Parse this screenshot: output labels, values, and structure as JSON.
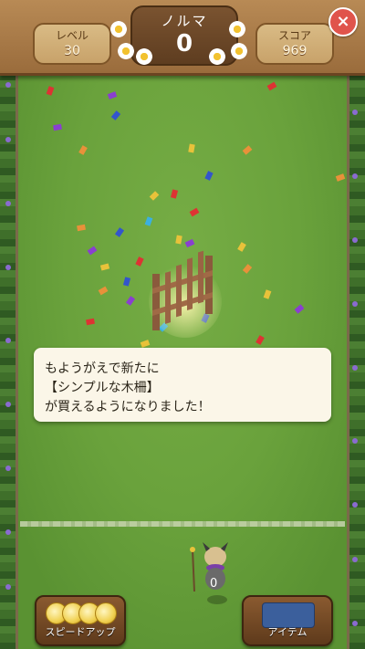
{
  "header": {
    "level": {
      "label": "レベル",
      "value": "30"
    },
    "quota": {
      "label": "ノルマ",
      "value": "0"
    },
    "score": {
      "label": "スコア",
      "value": "969"
    },
    "close_icon": "×"
  },
  "message": {
    "line1": "もようがえで新たに",
    "line2": "【シンプルな木柵】",
    "line3": "が買えるようになりました！"
  },
  "character": {
    "counter": "0"
  },
  "buttons": {
    "speedup_label": "スピードアップ",
    "item_label": "アイテム"
  },
  "colors": {
    "grass": "#6aa23c",
    "wood": "#9a6c3c",
    "close_button": "#e0544c",
    "message_bg": "#fbf6e8"
  },
  "icons": [
    "close-icon",
    "daisy-icon",
    "fence-icon",
    "coin-icon",
    "item-box-icon"
  ]
}
